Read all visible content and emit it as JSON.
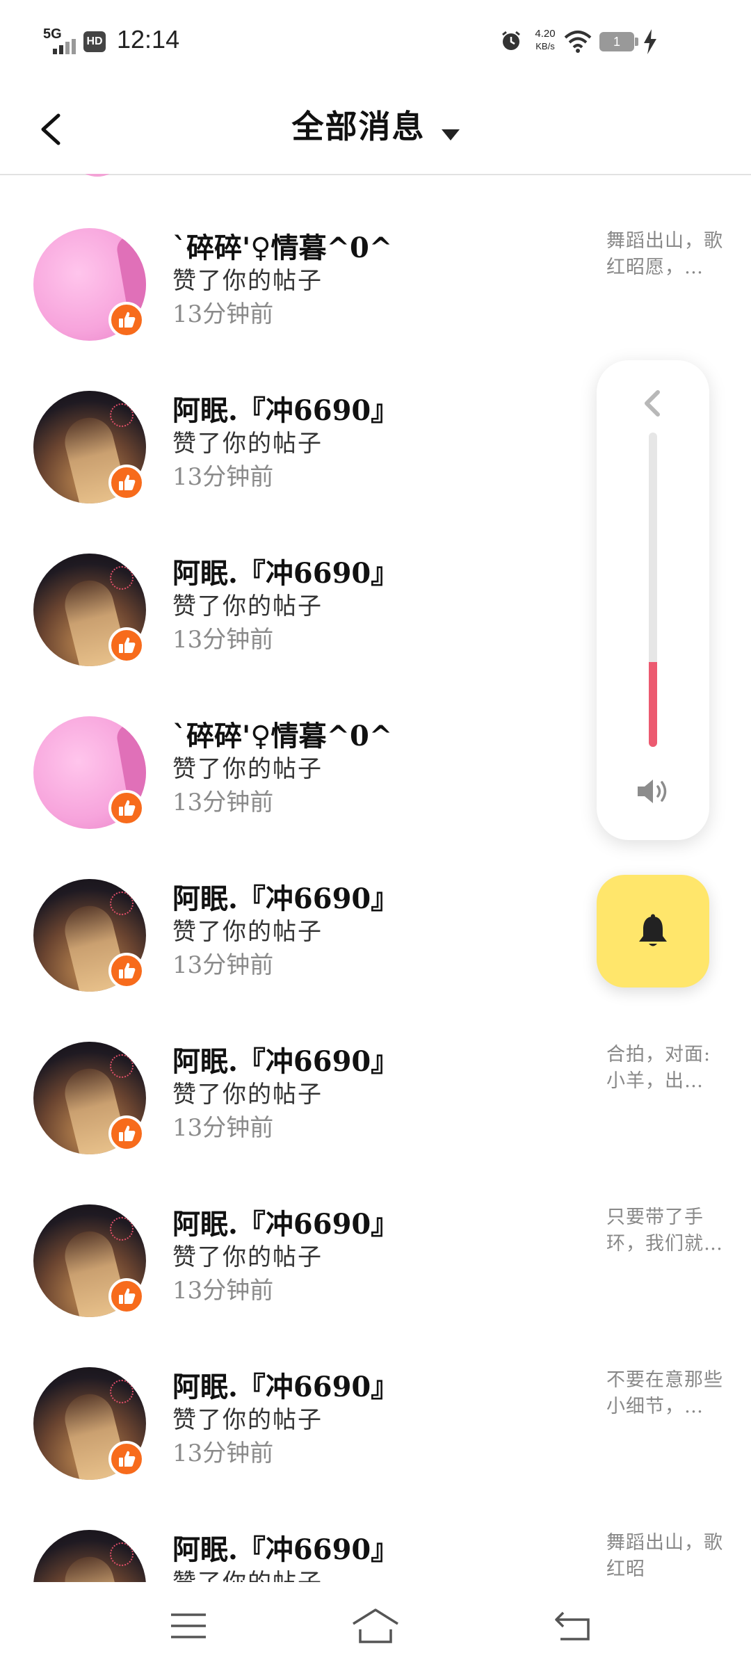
{
  "status_bar": {
    "signal": "5G",
    "hd": "HD",
    "time": "12:14",
    "net_speed_value": "4.20",
    "net_speed_unit": "KB/s",
    "battery": "1"
  },
  "header": {
    "title": "全部消息"
  },
  "messages": [
    {
      "name": "ˋ碎碎'♀情暮^0^",
      "action": "赞了你的帖子",
      "time": "13分钟前",
      "preview": "舞蹈出山，歌红昭愿，…",
      "avatar": "pink"
    },
    {
      "name": "阿眠.『冲6690』",
      "action": "赞了你的帖子",
      "time": "13分钟前",
      "preview": "",
      "avatar": "dark"
    },
    {
      "name": "阿眠.『冲6690』",
      "action": "赞了你的帖子",
      "time": "13分钟前",
      "preview": "",
      "avatar": "dark"
    },
    {
      "name": "ˋ碎碎'♀情暮^0^",
      "action": "赞了你的帖子",
      "time": "13分钟前",
      "preview": "",
      "avatar": "pink"
    },
    {
      "name": "阿眠.『冲6690』",
      "action": "赞了你的帖子",
      "time": "13分钟前",
      "preview": "",
      "avatar": "dark"
    },
    {
      "name": "阿眠.『冲6690』",
      "action": "赞了你的帖子",
      "time": "13分钟前",
      "preview": "合拍，对面:小羊，出…",
      "avatar": "dark"
    },
    {
      "name": "阿眠.『冲6690』",
      "action": "赞了你的帖子",
      "time": "13分钟前",
      "preview": "只要带了手环，我们就…",
      "avatar": "dark"
    },
    {
      "name": "阿眠.『冲6690』",
      "action": "赞了你的帖子",
      "time": "13分钟前",
      "preview": "不要在意那些小细节，…",
      "avatar": "dark"
    },
    {
      "name": "阿眠.『冲6690』",
      "action": "赞了你的帖子",
      "time": "",
      "preview": "舞蹈出山，歌红昭",
      "avatar": "dark"
    }
  ],
  "volume": {
    "level": 0.27,
    "fill_color": "#ec5a70"
  },
  "floating_button": {
    "icon": "bell-icon",
    "color": "#ffe66b"
  },
  "badge": {
    "icon": "thumbs-up-icon",
    "color": "#f76b1c"
  },
  "nav_bar": {
    "icons": [
      "menu-icon",
      "home-icon",
      "back-arrow-icon"
    ]
  }
}
